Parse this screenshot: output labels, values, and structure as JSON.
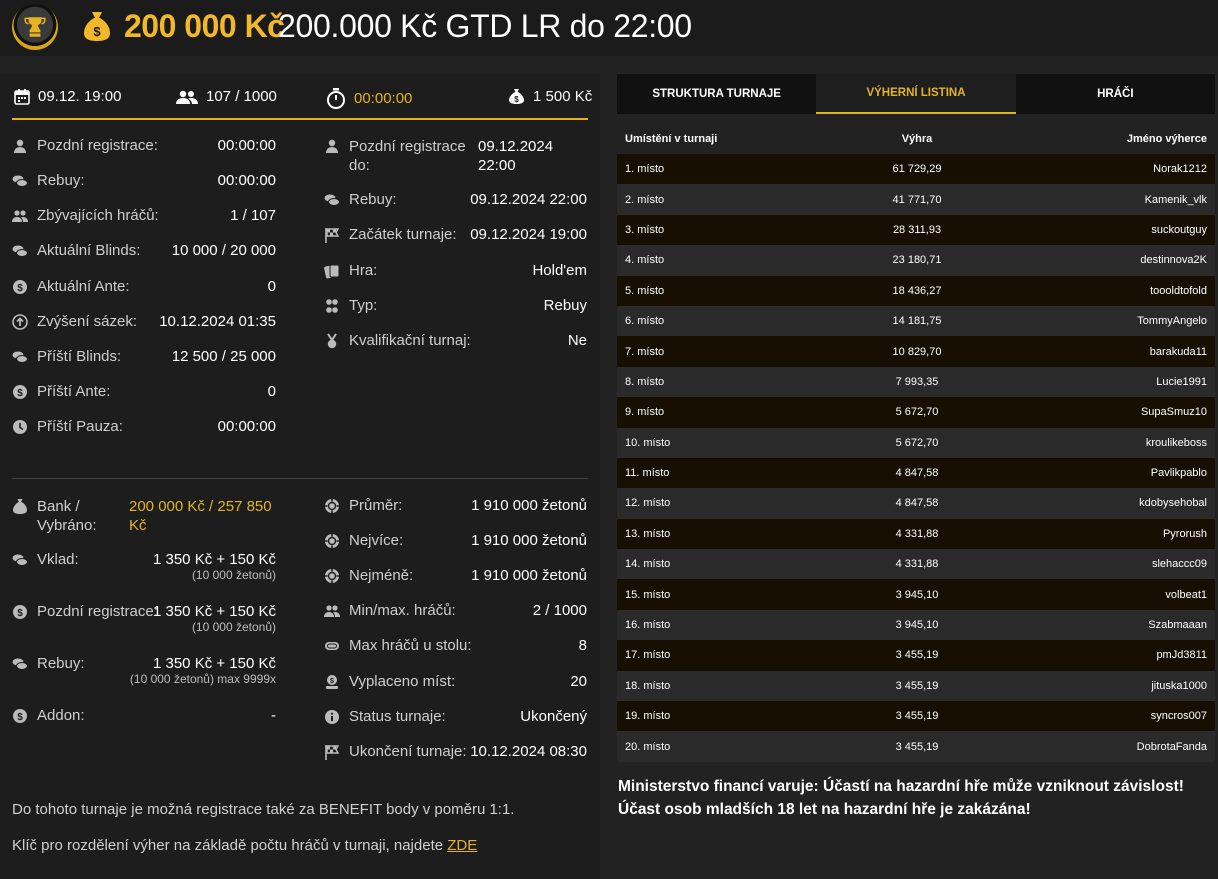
{
  "header": {
    "amount": "200 000 Kč",
    "title": "200.000 Kč GTD LR do 22:00"
  },
  "strip": {
    "date": "09.12. 19:00",
    "players": "107 / 1000",
    "timer": "00:00:00",
    "buyin": "1 500 Kč"
  },
  "left_col": [
    {
      "icon": "user-icon",
      "label": "Pozdní registrace:",
      "value": "00:00:00"
    },
    {
      "icon": "rebuy-icon",
      "label": "Rebuy:",
      "value": "00:00:00"
    },
    {
      "icon": "users-icon",
      "label": "Zbývajících hráčů:",
      "value": "1 / 107"
    },
    {
      "icon": "blinds-icon",
      "label": "Aktuální Blinds:",
      "value": "10 000 / 20 000"
    },
    {
      "icon": "ante-icon",
      "label": "Aktuální Ante:",
      "value": "0"
    },
    {
      "icon": "level-up-icon",
      "label": "Zvýšení sázek:",
      "value": "10.12.2024 01:35"
    },
    {
      "icon": "blinds-icon",
      "label": "Příští Blinds:",
      "value": "12 500 / 25 000"
    },
    {
      "icon": "ante-icon",
      "label": "Příští Ante:",
      "value": "0"
    },
    {
      "icon": "clock-icon",
      "label": "Příští Pauza:",
      "value": "00:00:00"
    }
  ],
  "right_col": [
    {
      "icon": "user-icon",
      "label": "Pozdní registrace do:",
      "value": "09.12.2024 22:00"
    },
    {
      "icon": "rebuy-icon",
      "label": "Rebuy:",
      "value": "09.12.2024 22:00"
    },
    {
      "icon": "flag-icon",
      "label": "Začátek turnaje:",
      "value": "09.12.2024 19:00"
    },
    {
      "icon": "cards-icon",
      "label": "Hra:",
      "value": "Hold'em"
    },
    {
      "icon": "clubs-icon",
      "label": "Typ:",
      "value": "Rebuy"
    },
    {
      "icon": "medal-icon",
      "label": "Kvalifikační turnaj:",
      "value": "Ne"
    }
  ],
  "bank": {
    "label": "Bank / Vybráno:",
    "value": "200 000 Kč / 257 850 Kč",
    "vklad_label": "Vklad:",
    "vklad_value": "1 350 Kč + 150 Kč",
    "vklad_note": "(10 000 žetonů)",
    "late_label": "Pozdní registrace:",
    "late_value": "1 350 Kč + 150 Kč",
    "late_note": "(10 000 žetonů)",
    "rebuy_label": "Rebuy:",
    "rebuy_value": "1 350 Kč + 150 Kč",
    "rebuy_note": "(10 000 žetonů) max 9999x",
    "addon_label": "Addon:",
    "addon_value": "-"
  },
  "stats": [
    {
      "icon": "chip-icon",
      "label": "Průměr:",
      "value": "1 910 000 žetonů"
    },
    {
      "icon": "chip-icon",
      "label": "Nejvíce:",
      "value": "1 910 000 žetonů"
    },
    {
      "icon": "chip-icon",
      "label": "Nejméně:",
      "value": "1 910 000 žetonů"
    },
    {
      "icon": "users-icon",
      "label": "Min/max. hráčů:",
      "value": "2 / 1000"
    },
    {
      "icon": "table-icon",
      "label": "Max hráčů u stolu:",
      "value": "8"
    },
    {
      "icon": "payout-icon",
      "label": "Vyplaceno míst:",
      "value": "20"
    },
    {
      "icon": "info-icon",
      "label": "Status turnaje:",
      "value": "Ukončený"
    },
    {
      "icon": "flag-icon",
      "label": "Ukončení turnaje:",
      "value": "10.12.2024 08:30"
    }
  ],
  "footer": {
    "benefit": "Do tohoto turnaje je možná registrace také za BENEFIT body v poměru 1:1.",
    "key_text": "Klíč pro rozdělení výher na základě počtu hráčů v turnaji, najdete ",
    "key_link": "ZDE"
  },
  "tabs": [
    "STRUKTURA TURNAJE",
    "VÝHERNÍ LISTINA",
    "HRÁČI"
  ],
  "table": {
    "headers": [
      "Umístění v turnaji",
      "Výhra",
      "Jméno výherce"
    ],
    "rows": [
      [
        "1. místo",
        "61 729,29",
        "Norak1212"
      ],
      [
        "2. místo",
        "41 771,70",
        "Kamenik_vlk"
      ],
      [
        "3. místo",
        "28 311,93",
        "suckoutguy"
      ],
      [
        "4. místo",
        "23 180,71",
        "destinnova2K"
      ],
      [
        "5. místo",
        "18 436,27",
        "tooold​tofold"
      ],
      [
        "6. místo",
        "14 181,75",
        "TommyAngelo"
      ],
      [
        "7. místo",
        "10 829,70",
        "barakuda11"
      ],
      [
        "8. místo",
        "7 993,35",
        "Lucie1991"
      ],
      [
        "9. místo",
        "5 672,70",
        "SupaSmuz10"
      ],
      [
        "10. místo",
        "5 672,70",
        "kroulikeboss"
      ],
      [
        "11. místo",
        "4 847,58",
        "Pavlikpablo"
      ],
      [
        "12. místo",
        "4 847,58",
        "kdobysehobal"
      ],
      [
        "13. místo",
        "4 331,88",
        "Pyrorush"
      ],
      [
        "14. místo",
        "4 331,88",
        "slehaccc09"
      ],
      [
        "15. místo",
        "3 945,10",
        "volbeat1"
      ],
      [
        "16. místo",
        "3 945,10",
        "Szabmaaan"
      ],
      [
        "17. místo",
        "3 455,19",
        "pmJd3811"
      ],
      [
        "18. místo",
        "3 455,19",
        "jituska1000"
      ],
      [
        "19. místo",
        "3 455,19",
        "syncros007"
      ],
      [
        "20. místo",
        "3 455,19",
        "DobrotaFanda"
      ]
    ]
  },
  "warning": {
    "line1": "Ministerstvo financí varuje: Účastí na hazardní hře může vzniknout závislost!",
    "line2": "Účast osob mladších 18 let na hazardní hře je zakázána!"
  }
}
